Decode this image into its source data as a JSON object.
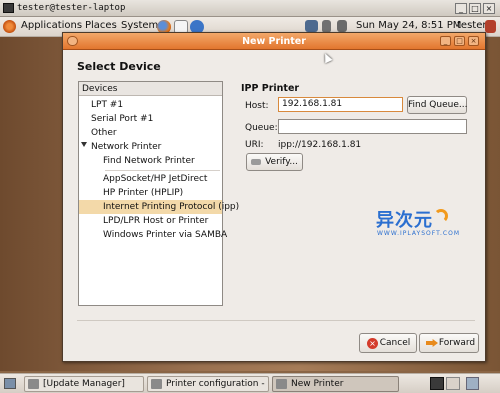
{
  "outer_window": {
    "title": "tester@tester-laptop"
  },
  "top_panel": {
    "menus": [
      "Applications",
      "Places",
      "System"
    ],
    "clock": "Sun May 24,  8:51 PM",
    "user": "tester"
  },
  "dialog": {
    "title": "New Printer",
    "heading": "Select Device",
    "device_list": {
      "header": "Devices",
      "items": [
        {
          "label": "LPT #1"
        },
        {
          "label": "Serial Port #1"
        },
        {
          "label": "Other"
        },
        {
          "label": "Network Printer"
        },
        {
          "label": "Find Network Printer"
        },
        {
          "label": "AppSocket/HP JetDirect"
        },
        {
          "label": "HP Printer (HPLIP)"
        },
        {
          "label": "Internet Printing Protocol (ipp)"
        },
        {
          "label": "LPD/LPR Host or Printer"
        },
        {
          "label": "Windows Printer via SAMBA"
        }
      ],
      "selected": "Internet Printing Protocol (ipp)"
    },
    "section_title": "IPP Printer",
    "host": {
      "label": "Host:",
      "value": "192.168.1.81"
    },
    "queue": {
      "label": "Queue:",
      "value": ""
    },
    "uri": {
      "label": "URI:",
      "value": "ipp://192.168.1.81"
    },
    "find_queue_label": "Find Queue...",
    "verify_label": "Verify...",
    "cancel_label": "Cancel",
    "forward_label": "Forward",
    "watermark": {
      "main": "异次元",
      "sub": "WWW.IPLAYSOFT.COM"
    }
  },
  "taskbar": {
    "tasks": [
      {
        "label": "[Update Manager]"
      },
      {
        "label": "Printer configuration - ..."
      },
      {
        "label": "New Printer"
      }
    ]
  },
  "colors": {
    "title_orange": "#e2762e",
    "selection": "#f3d9a9",
    "accent_blue": "#2b6fd0"
  }
}
